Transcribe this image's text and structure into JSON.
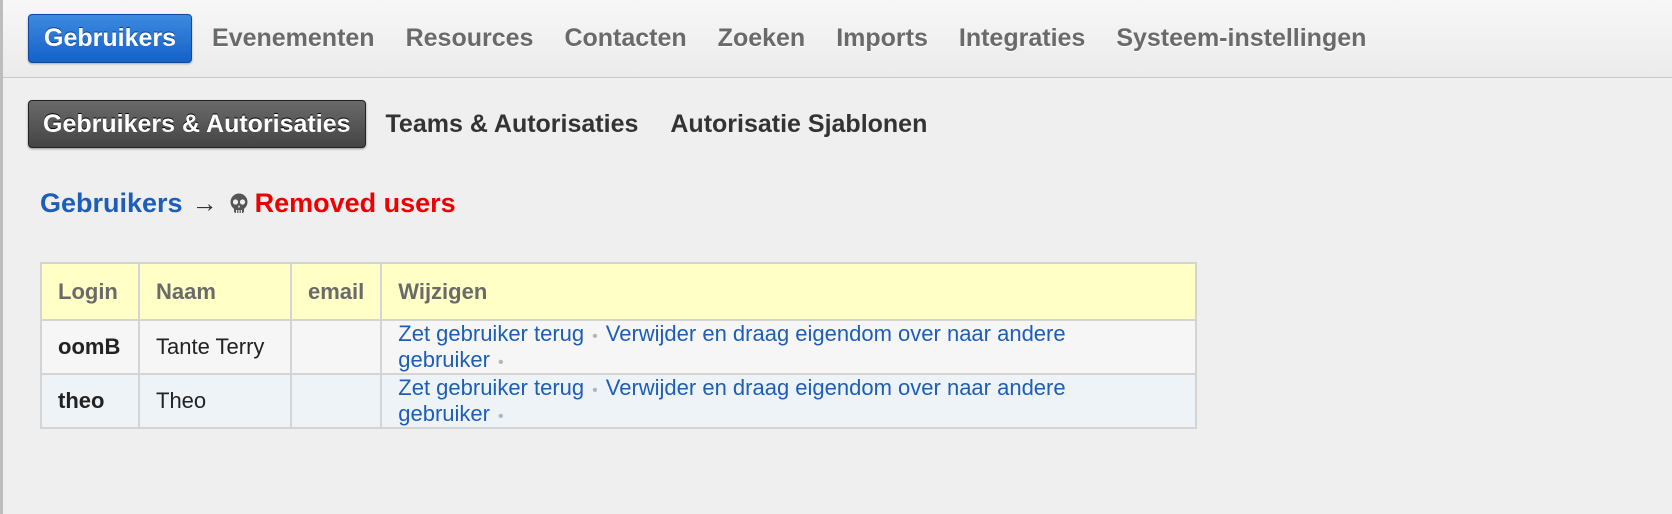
{
  "top_nav": {
    "items": [
      {
        "label": "Gebruikers",
        "active": true
      },
      {
        "label": "Evenementen",
        "active": false
      },
      {
        "label": "Resources",
        "active": false
      },
      {
        "label": "Contacten",
        "active": false
      },
      {
        "label": "Zoeken",
        "active": false
      },
      {
        "label": "Imports",
        "active": false
      },
      {
        "label": "Integraties",
        "active": false
      },
      {
        "label": "Systeem-instellingen",
        "active": false
      }
    ]
  },
  "sub_nav": {
    "items": [
      {
        "label": "Gebruikers & Autorisaties",
        "active": true
      },
      {
        "label": "Teams & Autorisaties",
        "active": false
      },
      {
        "label": "Autorisatie Sjablonen",
        "active": false
      }
    ]
  },
  "breadcrumb": {
    "root": "Gebruikers",
    "arrow": "→",
    "icon": "skull-icon",
    "current": "Removed users"
  },
  "table": {
    "headers": {
      "login": "Login",
      "naam": "Naam",
      "email": "email",
      "wijzigen": "Wijzigen"
    },
    "rows": [
      {
        "login": "oomB",
        "naam": "Tante Terry",
        "email": "",
        "restore": "Zet gebruiker terug",
        "delete": "Verwijder en draag eigendom over naar andere gebruiker",
        "sep": "•"
      },
      {
        "login": "theo",
        "naam": "Theo",
        "email": "",
        "restore": "Zet gebruiker terug",
        "delete": "Verwijder en draag eigendom over naar andere gebruiker",
        "sep": "•"
      }
    ]
  },
  "colors": {
    "accent_blue": "#1c5eb8",
    "active_tab": "#1461c8",
    "removed_red": "#e00000",
    "header_yellow": "#ffffc6"
  }
}
